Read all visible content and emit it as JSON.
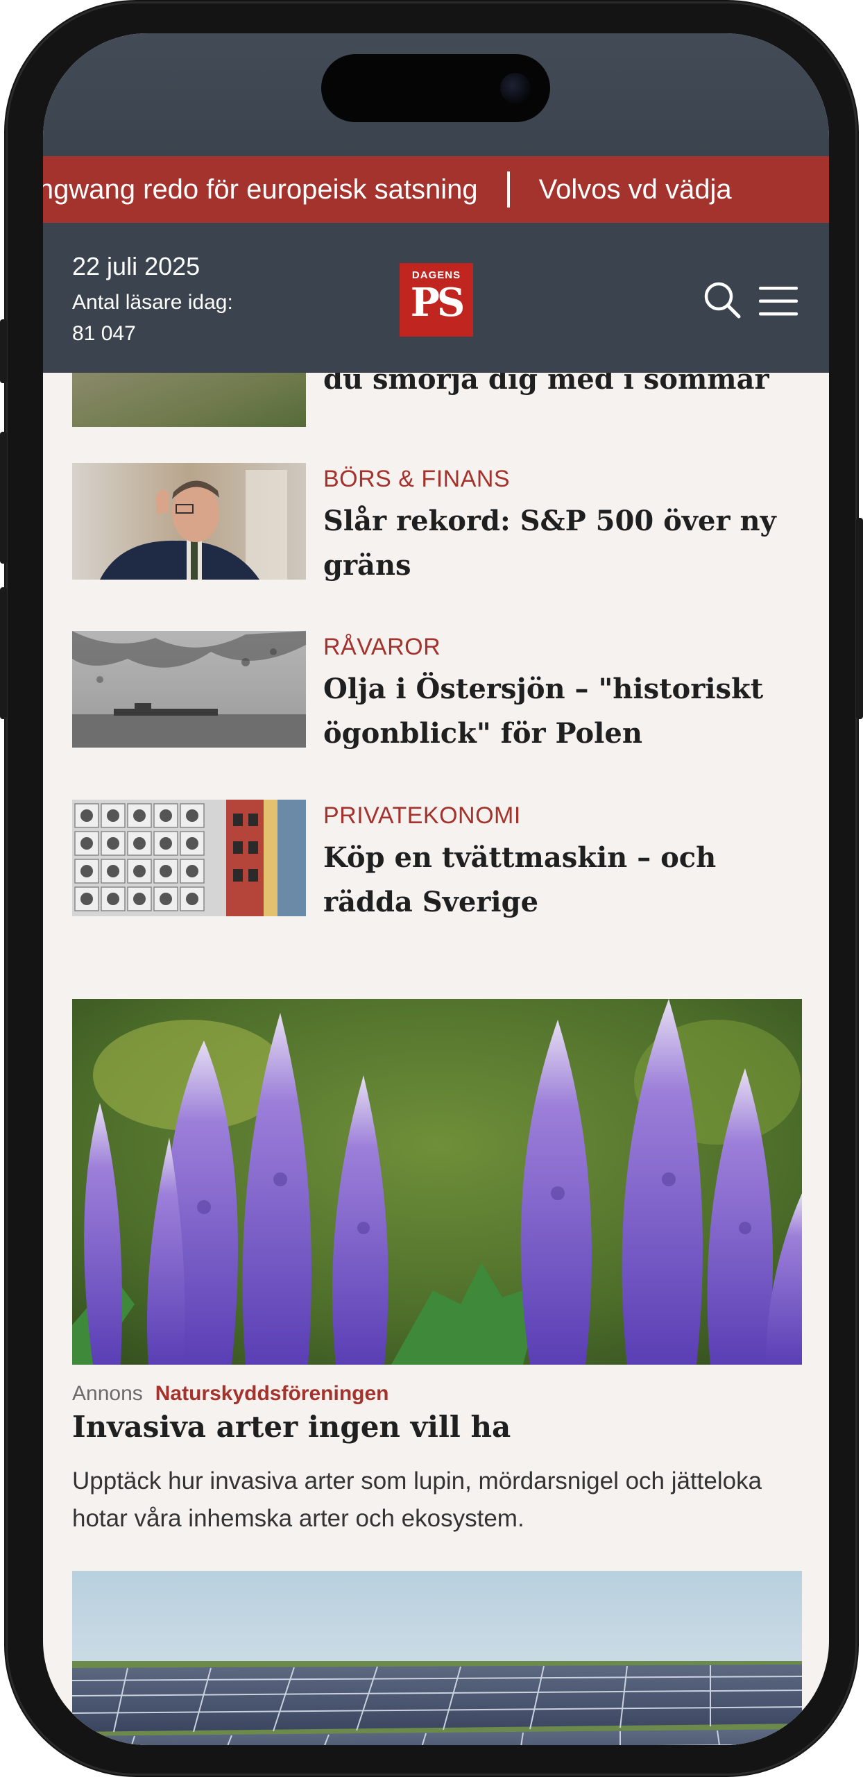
{
  "ticker": {
    "items": [
      "ingwang redo för europeisk satsning",
      "Volvos vd vädja"
    ]
  },
  "header": {
    "date": "22 juli 2025",
    "readers_label": "Antal läsare idag:",
    "readers_count": "81 047",
    "logo_top": "DAGENS",
    "logo_main": "PS"
  },
  "partial_article": {
    "title_fragment": "du smörja dig med i sommar"
  },
  "articles": [
    {
      "category": "BÖRS & FINANS",
      "title": "Slår rekord: S&P 500 över ny gräns"
    },
    {
      "category": "RÅVAROR",
      "title": "Olja i Östersjön – \"historiskt ögonblick\" för Polen"
    },
    {
      "category": "PRIVATEKONOMI",
      "title": "Köp en tvättmaskin – och rädda Sverige"
    }
  ],
  "ad": {
    "label": "Annons",
    "sponsor": "Naturskyddsföreningen",
    "title": "Invasiva arter ingen vill ha",
    "description": "Upptäck hur invasiva arter som lupin, mördarsnigel och jätteloka hotar våra inhemska arter och ekosystem."
  },
  "colors": {
    "accent": "#a3332c",
    "header_bg": "#3b434e",
    "page_bg": "#f6f2ef",
    "logo_red": "#c0261f"
  }
}
